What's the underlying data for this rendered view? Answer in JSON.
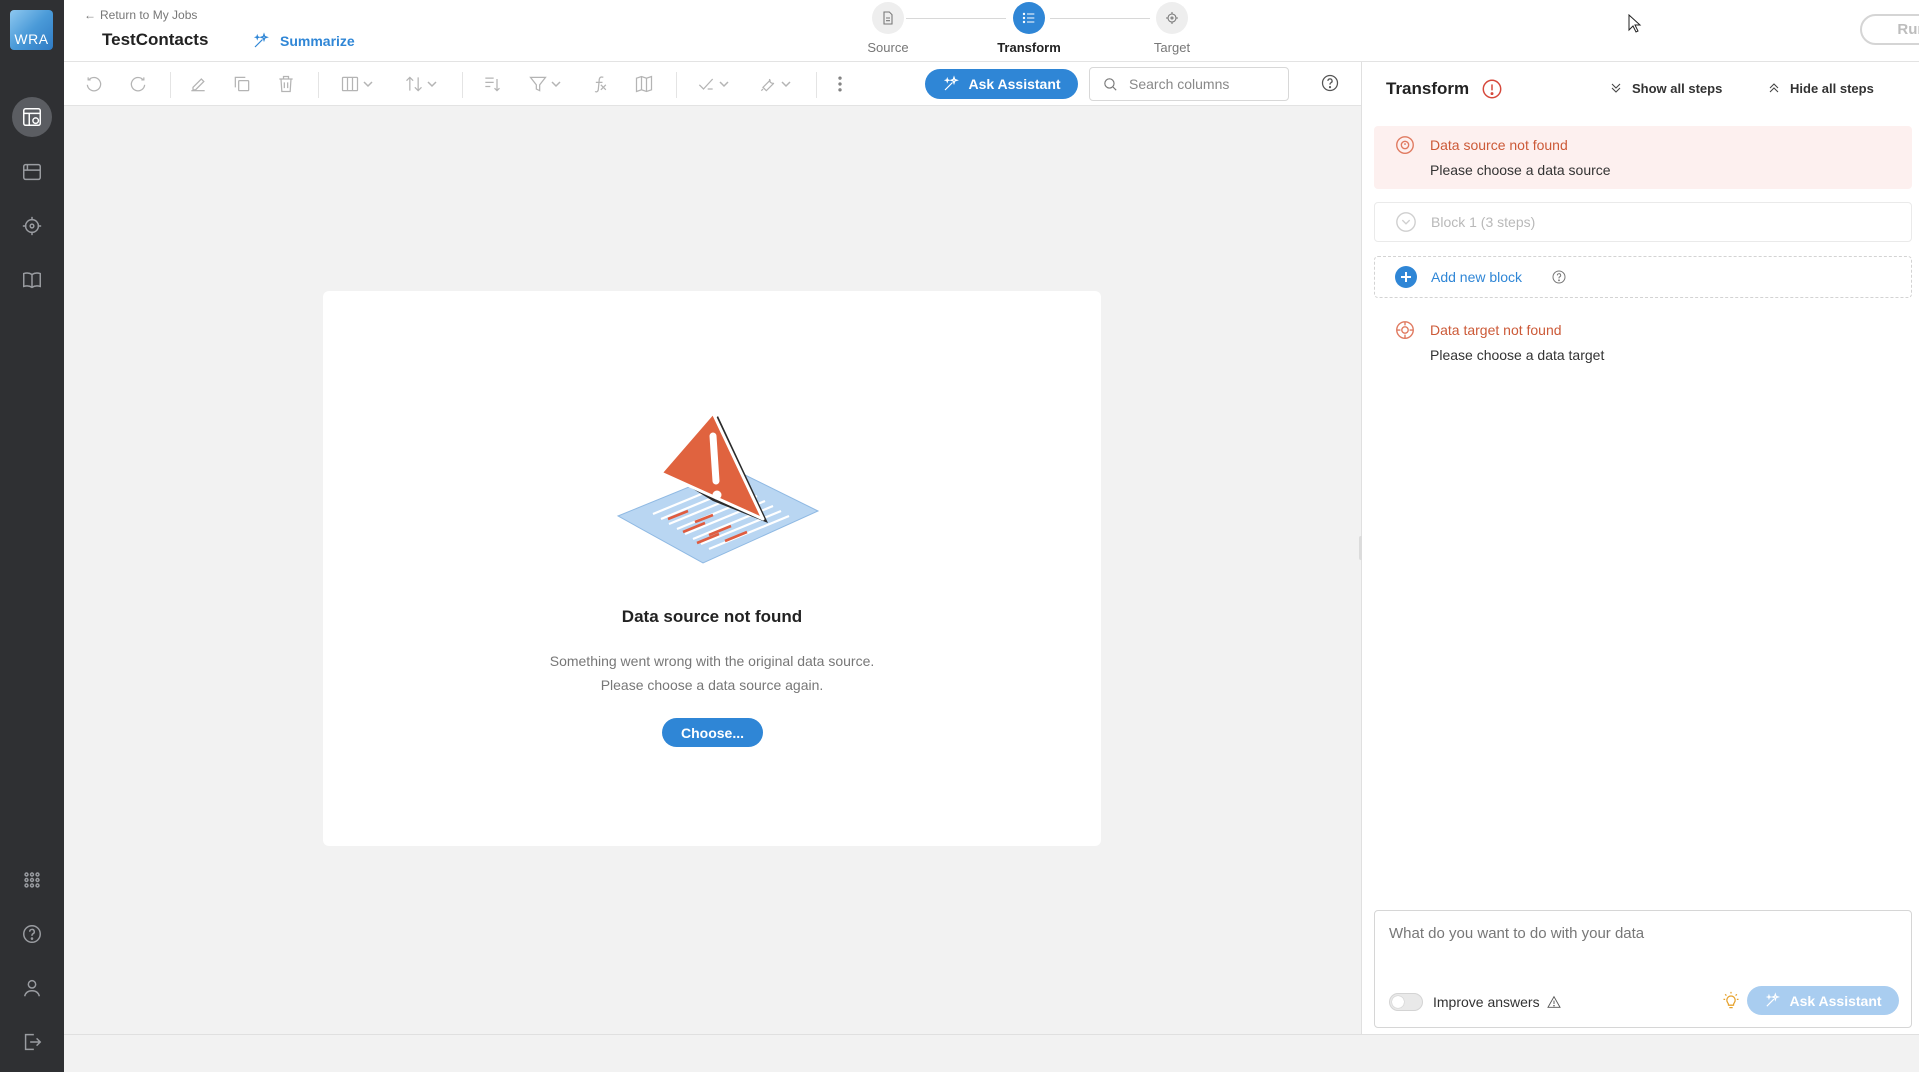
{
  "app": {
    "logo_text": "WRA"
  },
  "header": {
    "back_label": "Return to My Jobs",
    "job_title": "TestContacts",
    "summarize_label": "Summarize",
    "steps": [
      {
        "label": "Source",
        "icon": "document-icon",
        "active": false
      },
      {
        "label": "Transform",
        "icon": "list-icon",
        "active": true
      },
      {
        "label": "Target",
        "icon": "crosshair-icon",
        "active": false
      }
    ],
    "run_label": "Run"
  },
  "toolbar": {
    "ask_assistant_label": "Ask Assistant",
    "search_placeholder": "Search columns",
    "icons": [
      "undo-icon",
      "redo-icon",
      "edit-icon",
      "copy-icon",
      "delete-icon",
      "columns-icon",
      "sort-icon",
      "split-icon",
      "filter-icon",
      "formula-icon",
      "map-icon",
      "validate-icon",
      "tools-icon",
      "more-icon",
      "help-icon"
    ]
  },
  "canvas": {
    "error_title": "Data source not found",
    "error_line1": "Something went wrong with the original data source.",
    "error_line2": "Please choose a data source again.",
    "choose_label": "Choose..."
  },
  "panel": {
    "title": "Transform",
    "show_all_label": "Show all steps",
    "hide_all_label": "Hide all steps",
    "source_alert": {
      "title": "Data source not found",
      "subtitle": "Please choose a data source"
    },
    "block": {
      "label": "Block 1 (3 steps)"
    },
    "add_block_label": "Add new block",
    "target_alert": {
      "title": "Data target not found",
      "subtitle": "Please choose a data target"
    },
    "composer": {
      "placeholder": "What do you want to do with your data",
      "improve_label": "Improve answers",
      "improve_on": false,
      "ask_label": "Ask Assistant"
    }
  },
  "colors": {
    "accent": "#2f86d6",
    "error": "#d6483b",
    "error_text": "#cc5a38",
    "rail_bg": "#2f3033"
  }
}
